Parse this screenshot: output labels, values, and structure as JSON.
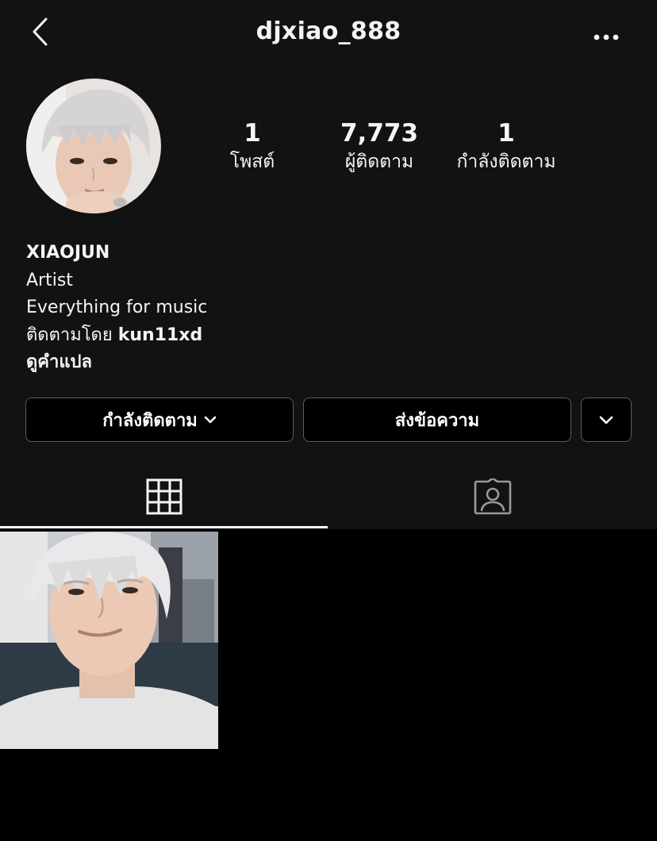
{
  "header": {
    "username": "djxiao_888",
    "back_icon": "chevron-left-icon",
    "more_icon": "ellipsis-icon"
  },
  "stats": {
    "posts": {
      "value": "1",
      "label": "โพสต์"
    },
    "followers": {
      "value": "7,773",
      "label": "ผู้ติดตาม"
    },
    "following": {
      "value": "1",
      "label": "กำลังติดตาม"
    }
  },
  "bio": {
    "name": "XIAOJUN",
    "category": "Artist",
    "description": "Everything for music",
    "followed_by_prefix": "ติดตามโดย ",
    "followed_by_user": "kun11xd",
    "translate": "ดูคำแปล"
  },
  "actions": {
    "following_label": "กำลังติดตาม",
    "message_label": "ส่งข้อความ"
  },
  "tabs": {
    "grid_icon": "grid-icon",
    "tagged_icon": "tagged-person-icon"
  },
  "colors": {
    "background": "#000000",
    "surface": "#121212",
    "text": "#f5f5f5",
    "button_border": "#5c5c5c"
  }
}
